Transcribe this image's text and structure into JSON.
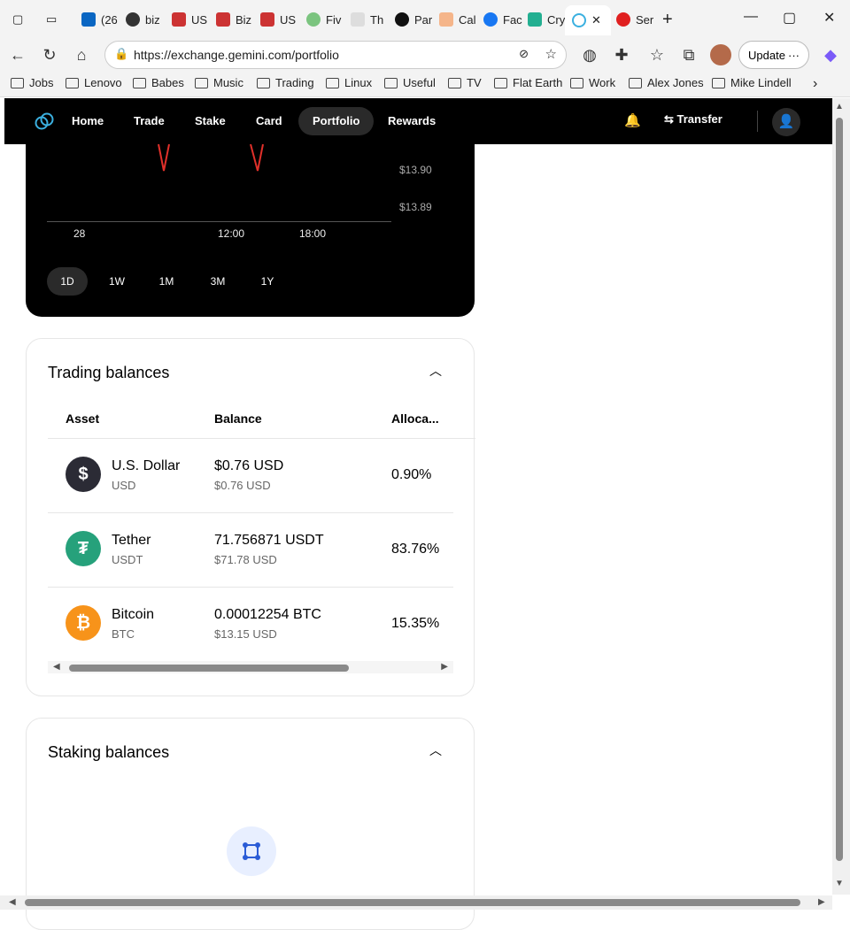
{
  "browser": {
    "tabs": [
      {
        "label": "",
        "icon": "tab-actions-icon"
      },
      {
        "label": "",
        "icon": "vertical-tabs-icon"
      },
      {
        "label": "(26",
        "icon": "linkedin-icon"
      },
      {
        "label": "biz",
        "icon": "github-icon"
      },
      {
        "label": "US",
        "icon": "flag-icon"
      },
      {
        "label": "Biz",
        "icon": "flag-icon"
      },
      {
        "label": "US",
        "icon": "flag-icon"
      },
      {
        "label": "Fiv",
        "icon": "fiverr-icon"
      },
      {
        "label": "Th",
        "icon": "amazon-icon"
      },
      {
        "label": "Par",
        "icon": "openai-icon"
      },
      {
        "label": "Cal",
        "icon": "calendar-icon"
      },
      {
        "label": "Fac",
        "icon": "facebook-icon"
      },
      {
        "label": "Cry",
        "icon": "kucoin-icon"
      },
      {
        "label": "",
        "icon": "gemini-icon"
      },
      {
        "label": "Ser",
        "icon": "opera-icon"
      }
    ],
    "url": "https://exchange.gemini.com/portfolio",
    "update_label": "Update",
    "bookmarks": [
      "Jobs",
      "Lenovo",
      "Babes",
      "Music",
      "Trading",
      "Linux",
      "Useful",
      "TV",
      "Flat Earth",
      "Work",
      "Alex Jones",
      "Mike Lindell"
    ]
  },
  "site": {
    "nav": [
      "Home",
      "Trade",
      "Stake",
      "Card",
      "Portfolio",
      "Rewards"
    ],
    "active_nav": "Portfolio",
    "transfer_label": "Transfer"
  },
  "chart": {
    "y_ticks": [
      "$13.90",
      "$13.89"
    ],
    "x_ticks": [
      "28",
      "12:00",
      "18:00"
    ],
    "ranges": [
      "1D",
      "1W",
      "1M",
      "3M",
      "1Y"
    ],
    "active_range": "1D"
  },
  "trading": {
    "title": "Trading balances",
    "columns": [
      "Asset",
      "Balance",
      "Alloca..."
    ],
    "rows": [
      {
        "name": "U.S. Dollar",
        "symbol": "USD",
        "balance": "$0.76 USD",
        "balance_usd": "$0.76 USD",
        "allocation": "0.90%",
        "color": "#2b2b35",
        "glyph": "$"
      },
      {
        "name": "Tether",
        "symbol": "USDT",
        "balance": "71.756871 USDT",
        "balance_usd": "$71.78 USD",
        "allocation": "83.76%",
        "color": "#26a17b",
        "glyph": "₮"
      },
      {
        "name": "Bitcoin",
        "symbol": "BTC",
        "balance": "0.00012254 BTC",
        "balance_usd": "$13.15 USD",
        "allocation": "15.35%",
        "color": "#f7931a",
        "glyph": "₿"
      }
    ]
  },
  "staking": {
    "title": "Staking balances"
  }
}
